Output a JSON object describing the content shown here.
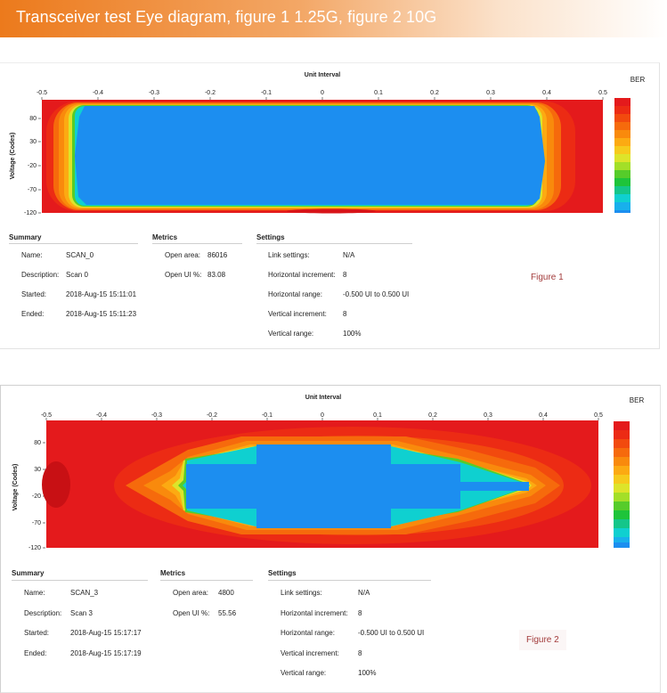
{
  "header": {
    "title": "Transceiver test Eye diagram, figure 1 1.25G, figure 2 10G"
  },
  "colors": {
    "ber_scale": [
      "#e41a1c",
      "#ec2b14",
      "#f24a0e",
      "#f66a0c",
      "#f98a0c",
      "#fcaa12",
      "#f6ca1c",
      "#dde42a",
      "#a3df28",
      "#56cc2a",
      "#1ec43a",
      "#14c68a",
      "#0fd0d0",
      "#18b0ec",
      "#1c8ef0"
    ],
    "eye_open": "#1c8ef0"
  },
  "figures": [
    {
      "chart": {
        "type": "heatmap",
        "title": "Unit Interval",
        "xlabel": "Unit Interval",
        "ylabel": "Voltage (Codes)",
        "x_ticks": [
          "-0.5",
          "-0.4",
          "-0.3",
          "-0.2",
          "-0.1",
          "0",
          "0.1",
          "0.2",
          "0.3",
          "0.4",
          "0.5"
        ],
        "y_ticks": [
          "80",
          "30",
          "-20",
          "-70",
          "-120"
        ],
        "legend_title": "BER"
      },
      "summary": {
        "title": "Summary",
        "rows": [
          {
            "label": "Name:",
            "value": "SCAN_0"
          },
          {
            "label": "Description:",
            "value": "Scan 0"
          },
          {
            "label": "Started:",
            "value": "2018-Aug-15 15:11:01"
          },
          {
            "label": "Ended:",
            "value": "2018-Aug-15 15:11:23"
          }
        ]
      },
      "metrics": {
        "title": "Metrics",
        "rows": [
          {
            "label": "Open area:",
            "value": "86016"
          },
          {
            "label": "Open UI %:",
            "value": "83.08"
          }
        ]
      },
      "settings": {
        "title": "Settings",
        "rows": [
          {
            "label": "Link settings:",
            "value": "N/A"
          },
          {
            "label": "Horizontal increment:",
            "value": "8"
          },
          {
            "label": "Horizontal range:",
            "value": "-0.500 UI to 0.500 UI"
          },
          {
            "label": "Vertical increment:",
            "value": "8"
          },
          {
            "label": "Vertical range:",
            "value": "100%"
          }
        ]
      },
      "figure_label": "Figure 1"
    },
    {
      "chart": {
        "type": "heatmap",
        "title": "Unit Interval",
        "xlabel": "Unit Interval",
        "ylabel": "Voltage (Codes)",
        "x_ticks": [
          "-0.5",
          "-0.4",
          "-0.3",
          "-0.2",
          "-0.1",
          "0",
          "0.1",
          "0.2",
          "0.3",
          "0.4",
          "0.5"
        ],
        "y_ticks": [
          "80",
          "30",
          "-20",
          "-70",
          "-120"
        ],
        "legend_title": "BER"
      },
      "summary": {
        "title": "Summary",
        "rows": [
          {
            "label": "Name:",
            "value": "SCAN_3"
          },
          {
            "label": "Description:",
            "value": "Scan 3"
          },
          {
            "label": "Started:",
            "value": "2018-Aug-15 15:17:17"
          },
          {
            "label": "Ended:",
            "value": "2018-Aug-15 15:17:19"
          }
        ]
      },
      "metrics": {
        "title": "Metrics",
        "rows": [
          {
            "label": "Open area:",
            "value": "4800"
          },
          {
            "label": "Open UI %:",
            "value": "55.56"
          }
        ]
      },
      "settings": {
        "title": "Settings",
        "rows": [
          {
            "label": "Link settings:",
            "value": "N/A"
          },
          {
            "label": "Horizontal increment:",
            "value": "8"
          },
          {
            "label": "Horizontal range:",
            "value": "-0.500 UI to 0.500 UI"
          },
          {
            "label": "Vertical increment:",
            "value": "8"
          },
          {
            "label": "Vertical range:",
            "value": "100%"
          }
        ]
      },
      "figure_label": "Figure 2"
    }
  ]
}
